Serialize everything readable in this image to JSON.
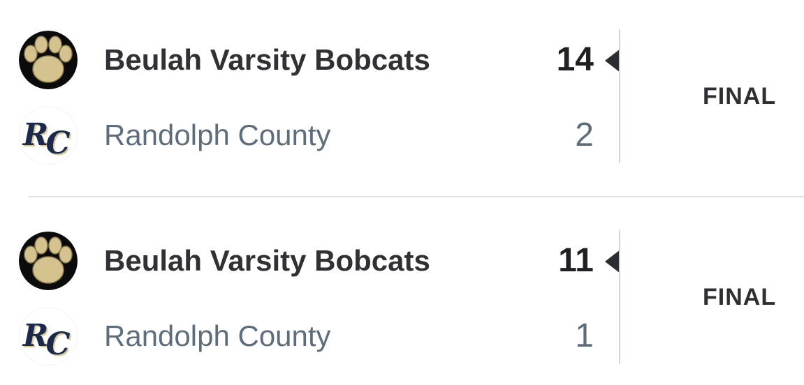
{
  "games": [
    {
      "status": "FINAL",
      "home": {
        "name": "Beulah Varsity Bobcats",
        "score": "14",
        "logo": "paw-print-icon",
        "winner": true
      },
      "away": {
        "name": "Randolph County",
        "score": "2",
        "logo": "rc-monogram-icon",
        "winner": false
      }
    },
    {
      "status": "FINAL",
      "home": {
        "name": "Beulah Varsity Bobcats",
        "score": "11",
        "logo": "paw-print-icon",
        "winner": true
      },
      "away": {
        "name": "Randolph County",
        "score": "1",
        "logo": "rc-monogram-icon",
        "winner": false
      }
    }
  ],
  "colors": {
    "winner_text": "#303134",
    "loser_text": "#5e6d7c",
    "paw_gold": "#d4c28f",
    "rc_navy": "#1b2a4a",
    "divider": "#cdd6de"
  }
}
